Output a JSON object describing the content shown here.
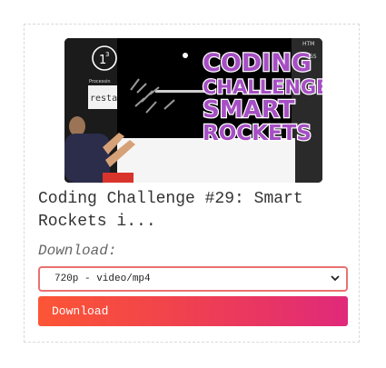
{
  "video": {
    "title": "Coding Challenge #29: Smart Rockets i...",
    "thumbnail": {
      "overlay_line1": "CODING",
      "overlay_line2": "CHALLENGE:",
      "overlay_line3": "SMART",
      "overlay_line4": "ROCKETS",
      "side_text_1": "restar",
      "side_text_2": "Processin",
      "side_text_3": "HTM",
      "side_text_4": "SS",
      "overlay_color": "#a64fc4"
    }
  },
  "download": {
    "label": "Download:",
    "selected_option": "720p - video/mp4",
    "button_label": "Download"
  },
  "colors": {
    "select_border": "#e9716f",
    "button_gradient_start": "#fc5535",
    "button_gradient_end": "#e0297a"
  }
}
